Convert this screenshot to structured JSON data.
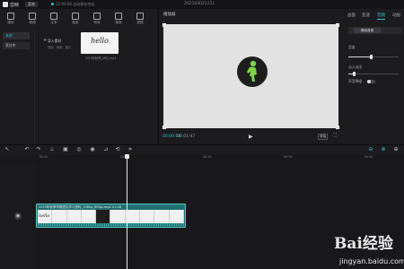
{
  "titlebar": {
    "app_name": "剪映",
    "menu_label": "菜单",
    "status_text": "12:00:00 自动保存完成",
    "doc_title": "202104021221"
  },
  "toolbar": {
    "items": [
      {
        "label": "媒体",
        "icon": "media-icon",
        "active": true
      },
      {
        "label": "音频",
        "icon": "audio-icon",
        "active": false
      },
      {
        "label": "文本",
        "icon": "text-icon",
        "active": false
      },
      {
        "label": "贴纸",
        "icon": "sticker-icon",
        "active": false
      },
      {
        "label": "特效",
        "icon": "effects-icon",
        "active": false
      },
      {
        "label": "转场",
        "icon": "transition-icon",
        "active": false
      },
      {
        "label": "滤镜",
        "icon": "filter-icon",
        "active": false
      }
    ]
  },
  "leftnav": {
    "items": [
      {
        "label": "本地",
        "active": true
      },
      {
        "label": "素材库",
        "active": false
      }
    ]
  },
  "media": {
    "import_label": "导入素材",
    "import_hint": "视频、音频、图片",
    "thumb_text": "hello",
    "thumb_name": "2019年秋季_[66]_mp4"
  },
  "player": {
    "title": "播放器",
    "timecode_current": "00:00:00",
    "timecode_total": "00:01:47",
    "ratio_label": "原始"
  },
  "right_panel": {
    "tabs": [
      {
        "label": "画面",
        "active": false
      },
      {
        "label": "变速",
        "active": false
      },
      {
        "label": "音频",
        "active": true
      },
      {
        "label": "动画",
        "active": false
      }
    ],
    "segment_option": "基础音频",
    "volume_label": "音量",
    "volume_level": 0.45,
    "fade_label": "淡入淡出",
    "fade_level": 0.1,
    "denoise_label": "声音降噪"
  },
  "timeline": {
    "ticks": [
      "00:00",
      "00:10",
      "00:20",
      "00:30",
      "00:40"
    ],
    "clip_name": "2019年秋季学期语文学习资料_1080p_60fps.mp4    01:46",
    "thumb_text": "hello"
  },
  "watermark": {
    "brand": "Bai经验",
    "url": "jingyan.baidu.com"
  },
  "colors": {
    "accent": "#25c2d4",
    "background": "#18181a",
    "panel": "#1c1c1f",
    "clip": "#1f6f73",
    "figure": "#7fd24a"
  }
}
